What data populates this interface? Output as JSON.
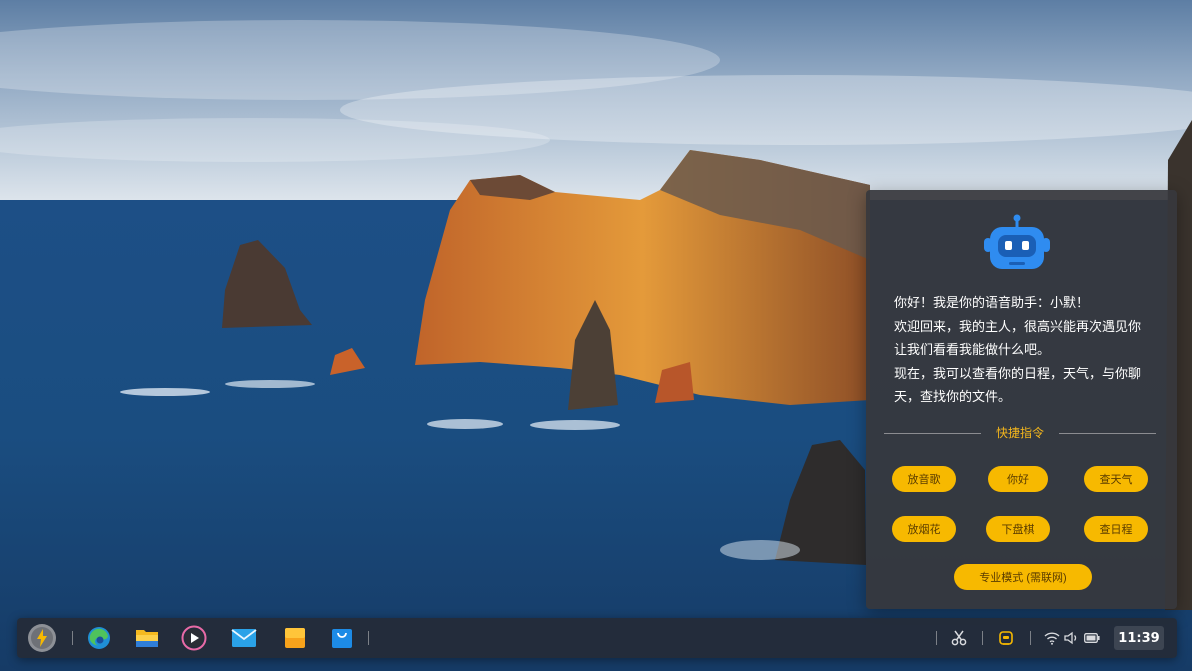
{
  "assistant": {
    "greeting_lines": [
      "你好！我是你的语音助手：小默！",
      "欢迎回来，我的主人，很高兴能再次遇见你",
      "让我们看看我能做什么吧。",
      "现在，我可以查看你的日程，天气，与你聊",
      "天，查找你的文件。"
    ],
    "quick_commands_title": "快捷指令",
    "commands": [
      "放音歌",
      "你好",
      "查天气",
      "放烟花",
      "下盘棋",
      "查日程"
    ],
    "pro_mode_label": "专业模式 (需联网)"
  },
  "taskbar": {
    "apps": [
      "launcher-icon",
      "edge-browser-icon",
      "file-manager-icon",
      "media-player-icon",
      "mail-icon",
      "notes-icon",
      "app-store-icon"
    ],
    "tray": [
      "screenshot-icon",
      "assistant-icon",
      "wifi-icon",
      "volume-icon",
      "battery-icon"
    ],
    "clock": "11:39"
  },
  "colors": {
    "accent": "#f7b900",
    "accent_text": "#f3b61d",
    "panel_bg": "#37383c",
    "taskbar_bg": "#262a34"
  }
}
